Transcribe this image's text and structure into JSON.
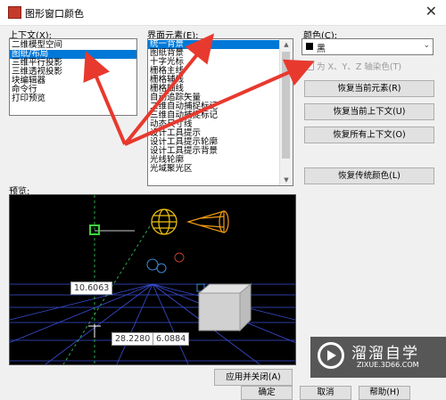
{
  "window": {
    "title": "图形窗口颜色",
    "close_glyph": "✕"
  },
  "context": {
    "label": "上下文(X):",
    "items": [
      "二维模型空间",
      "图纸/布局",
      "三维平行投影",
      "三维透视投影",
      "块编辑器",
      "命令行",
      "打印预览"
    ],
    "selected_index": 1
  },
  "interface": {
    "label": "界面元素(E):",
    "items": [
      "统一背景",
      "图纸背景",
      "十字光标",
      "栅格主线",
      "栅格辅线",
      "栅格轴线",
      "自动追踪矢量",
      "二维自动捕捉标记",
      "三维自动捕捉标记",
      "动态尺寸线",
      "设计工具提示",
      "设计工具提示轮廓",
      "设计工具提示背景",
      "光线轮廓",
      "光域聚光区"
    ],
    "selected_index": 0
  },
  "color": {
    "label": "颜色(C):",
    "value": "黑",
    "swatch": "#000000"
  },
  "tint_checkbox": {
    "label": "为 X、Y、Z 轴染色(T)",
    "checked": false
  },
  "buttons": {
    "restore_element": "恢复当前元素(R)",
    "restore_context": "恢复当前上下文(U)",
    "restore_all": "恢复所有上下文(O)",
    "restore_classic": "恢复传统颜色(L)",
    "apply_close": "应用并关闭(A)",
    "ok": "确定",
    "cancel": "取消",
    "help": "帮助(H)"
  },
  "preview": {
    "label": "预览:",
    "dim1": "10.6063",
    "dim2": "28.2280",
    "dim3": "6.0884"
  },
  "watermark": {
    "title": "溜溜自学",
    "url": "ZIXUE.3D66.COM"
  },
  "colors": {
    "selection": "#0078d7",
    "annotation_arrow": "#e8392e",
    "grid": "#3a4fd8",
    "axis_green": "#2ea84a"
  }
}
